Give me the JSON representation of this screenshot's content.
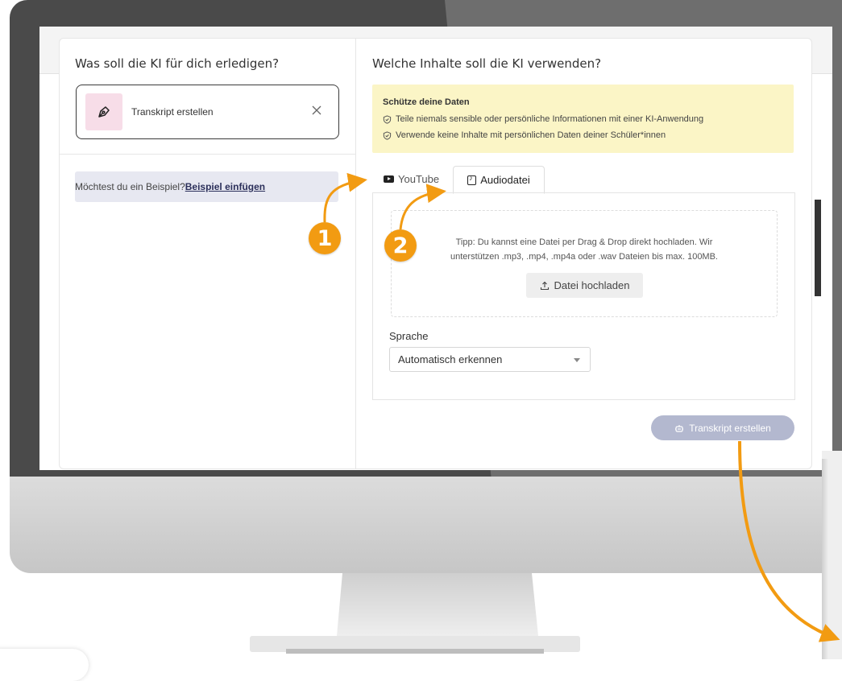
{
  "left_panel": {
    "title": "Was soll die KI für dich erledigen?",
    "task": {
      "label": "Transkript erstellen",
      "icon": "pen-nib-icon",
      "close_icon": "close-icon"
    },
    "example": {
      "text": "Möchtest du ein Beispiel?",
      "link": "Beispiel einfügen"
    }
  },
  "right_panel": {
    "title": "Welche Inhalte soll die KI verwenden?",
    "warning": {
      "title": "Schütze deine Daten",
      "lines": [
        "Teile niemals sensible oder persönliche Informationen mit einer KI-Anwendung",
        "Verwende keine Inhalte mit persönlichen Daten deiner Schüler*innen"
      ],
      "bg_color": "#fbf5c6"
    },
    "tabs": [
      {
        "label": "YouTube",
        "icon": "youtube-icon",
        "active": false
      },
      {
        "label": "Audiodatei",
        "icon": "audio-file-icon",
        "active": true
      }
    ],
    "dropzone": {
      "tip_line1": "Tipp: Du kannst eine Datei per Drag & Drop direkt hochladen. Wir",
      "tip_line2": "unterstützen .mp3, .mp4, .mp4a oder .wav Dateien bis max. 100MB.",
      "upload_label": "Datei hochladen"
    },
    "language": {
      "label": "Sprache",
      "value": "Automatisch erkennen"
    },
    "submit_label": "Transkript erstellen"
  },
  "annotations": {
    "badge1": "1",
    "badge2": "2",
    "accent_color": "#f29b12"
  }
}
